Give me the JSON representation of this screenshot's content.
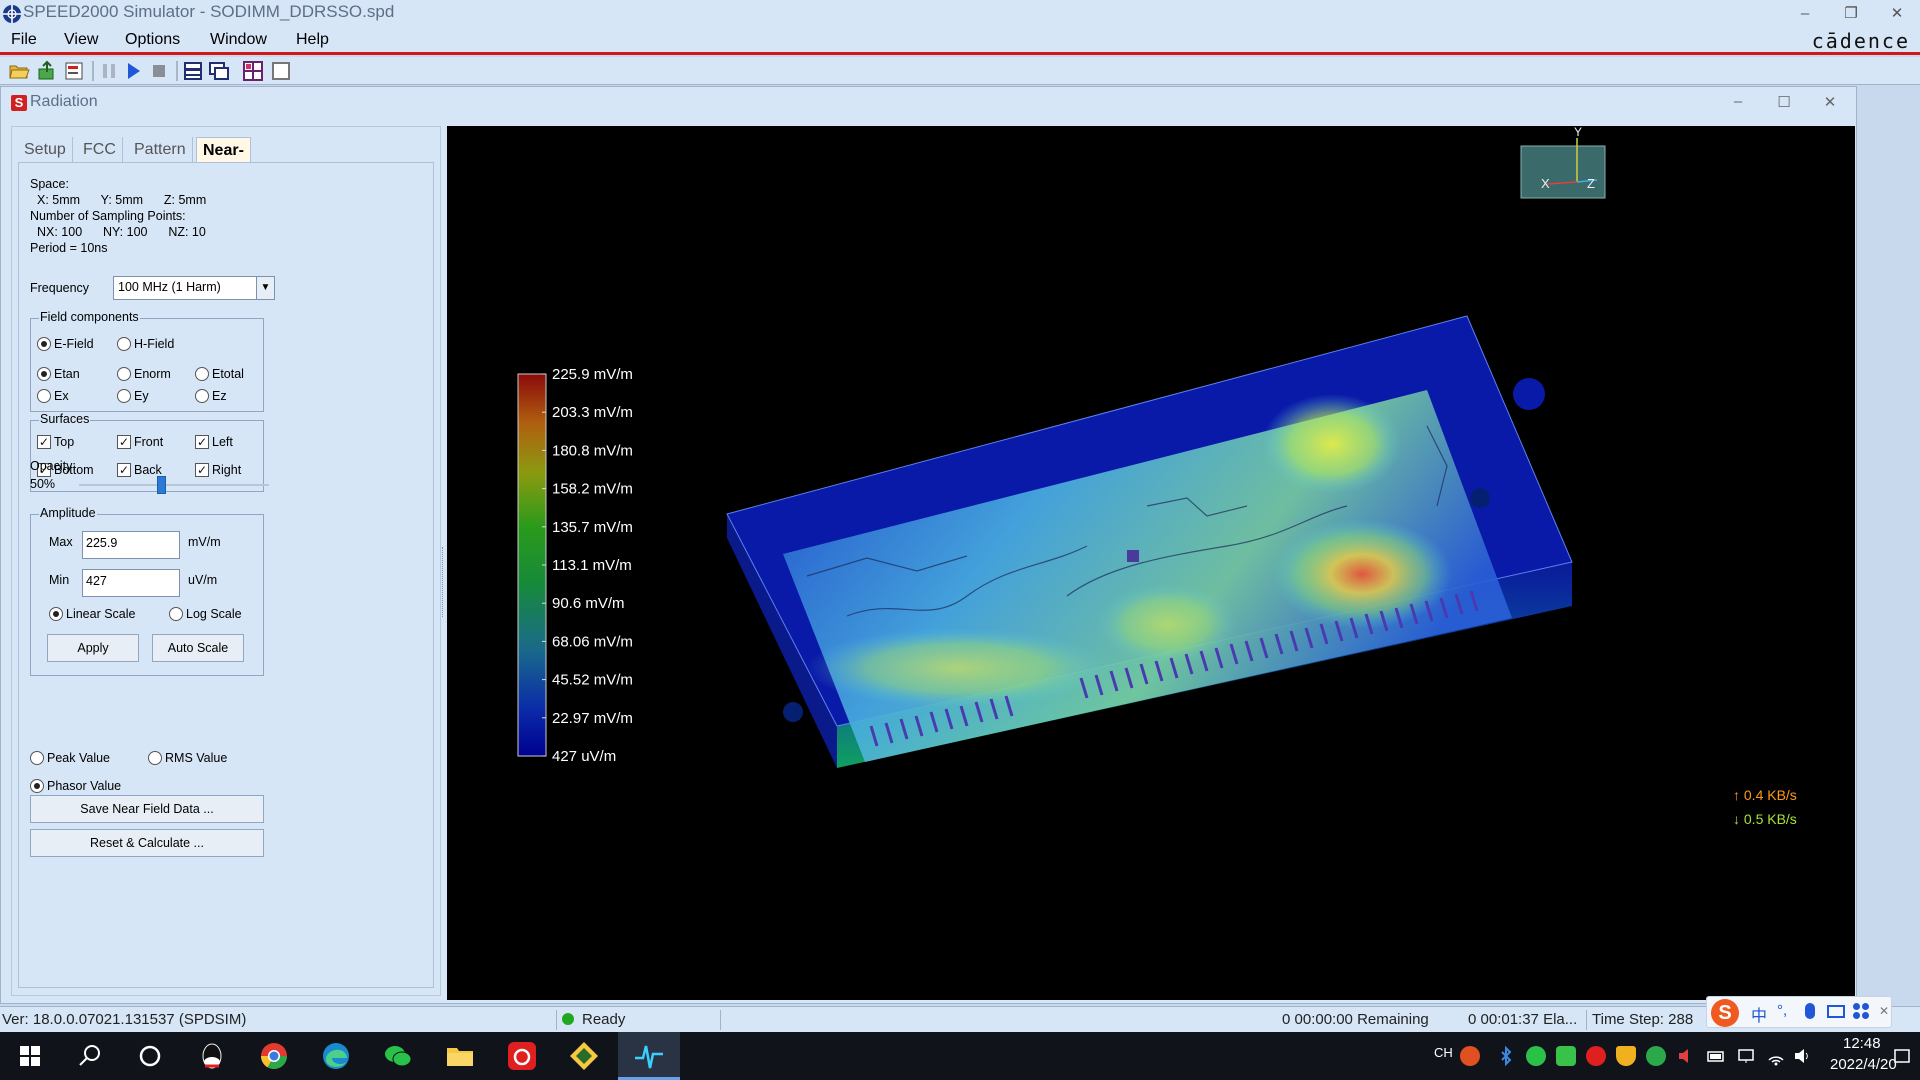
{
  "app": {
    "title": "SPEED2000 Simulator - SODIMM_DDRSSO.spd",
    "brand": "cādence"
  },
  "menu": [
    {
      "label": "File"
    },
    {
      "label": "View"
    },
    {
      "label": "Options"
    },
    {
      "label": "Window"
    },
    {
      "label": "Help"
    }
  ],
  "toolbar_icons": [
    "open-folder-icon",
    "import-icon",
    "report-icon",
    "pause-icon",
    "play-icon",
    "stop-icon",
    "horizontal-split-icon",
    "cascade-windows-icon",
    "tile-grid-icon",
    "fullscreen-icon"
  ],
  "radiation": {
    "title": "Radiation",
    "icon_letter": "S",
    "tabs": [
      {
        "label": "Setup"
      },
      {
        "label": "FCC"
      },
      {
        "label": "Pattern"
      },
      {
        "label": "Near-Field",
        "active": true
      }
    ],
    "info": {
      "space": "Space:",
      "space_vals": "X: 5mm      Y: 5mm      Z: 5mm",
      "sampling": "Number of Sampling Points:",
      "sampling_vals": "NX: 100      NY: 100      NZ: 10",
      "period": "Period = 10ns"
    },
    "frequency": {
      "label": "Frequency",
      "value": "100 MHz (1 Harm)"
    },
    "field_components": {
      "title": "Field components",
      "efield": "E-Field",
      "hfield": "H-Field",
      "etan": "Etan",
      "enorm": "Enorm",
      "etotal": "Etotal",
      "ex": "Ex",
      "ey": "Ey",
      "ez": "Ez"
    },
    "surfaces": {
      "title": "Surfaces",
      "top": "Top",
      "front": "Front",
      "left": "Left",
      "bottom": "Bottom",
      "back": "Back",
      "right": "Right"
    },
    "opacity": {
      "label": "Opacity:",
      "value_text": "50%",
      "value": 0.5
    },
    "amplitude": {
      "title": "Amplitude",
      "max_label": "Max",
      "max_value": "225.9",
      "max_unit": "mV/m",
      "min_label": "Min",
      "min_value": "427",
      "min_unit": "uV/m",
      "linear": "Linear Scale",
      "log": "Log Scale",
      "apply": "Apply",
      "auto_scale": "Auto Scale"
    },
    "value_type": {
      "peak": "Peak Value",
      "rms": "RMS Value",
      "phasor": "Phasor Value"
    },
    "save_button": "Save Near Field Data ...",
    "reset_button": "Reset & Calculate ..."
  },
  "viewport": {
    "legend_labels": [
      "225.9 mV/m",
      "203.3 mV/m",
      "180.8 mV/m",
      "158.2 mV/m",
      "135.7 mV/m",
      "113.1 mV/m",
      "90.6 mV/m",
      "68.06 mV/m",
      "45.52 mV/m",
      "22.97 mV/m",
      "427 uV/m"
    ],
    "axis_y": "Y",
    "axis_x": "X",
    "axis_z": "Z",
    "net_up": "↑ 0.4 KB/s",
    "net_down": "↓ 0.5 KB/s",
    "net_up_color": "#ff9a1a",
    "net_down_color": "#a8e23a"
  },
  "status": {
    "version": "Ver: 18.0.0.07021.131537   (SPDSIM)",
    "ready": "Ready",
    "remaining": "0 00:00:00 Remaining",
    "elapsed": "0 00:01:37 Ela...",
    "time_step": "Time Step: 288"
  },
  "taskbar": {
    "lang": "CH",
    "time": "12:48",
    "date": "2022/4/20"
  },
  "ime": {
    "zh": "中",
    "punct": "°,"
  }
}
